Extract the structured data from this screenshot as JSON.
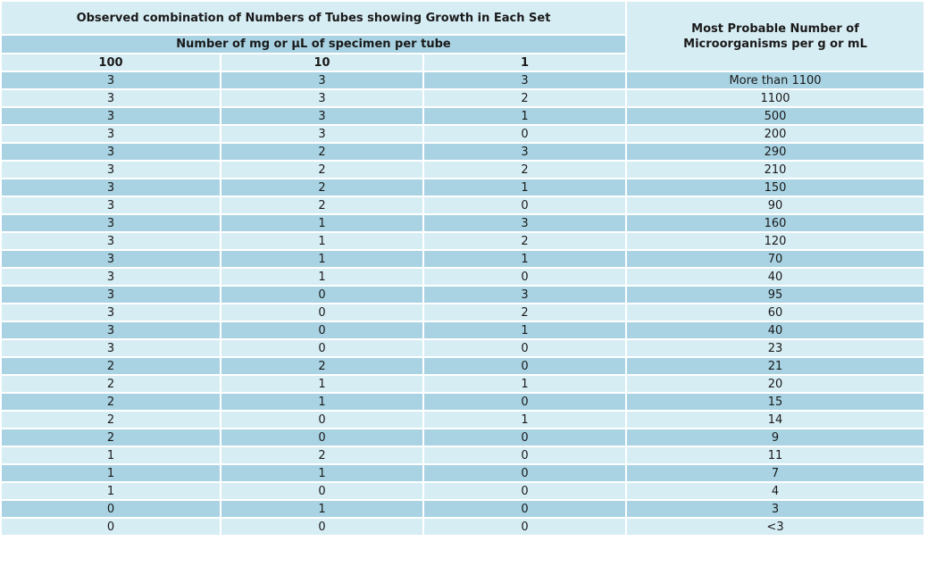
{
  "table": {
    "observed_title": "Observed combination of Numbers of Tubes showing Growth in Each Set",
    "specimen_title": "Number of mg or μL of specimen per tube",
    "mpn_title": "Most Probable Number of Microorganisms per g or mL",
    "columns": [
      "100",
      "10",
      "1"
    ],
    "rows": [
      [
        "3",
        "3",
        "3",
        "More than 1100"
      ],
      [
        "3",
        "3",
        "2",
        "1100"
      ],
      [
        "3",
        "3",
        "1",
        "500"
      ],
      [
        "3",
        "3",
        "0",
        "200"
      ],
      [
        "3",
        "2",
        "3",
        "290"
      ],
      [
        "3",
        "2",
        "2",
        "210"
      ],
      [
        "3",
        "2",
        "1",
        "150"
      ],
      [
        "3",
        "2",
        "0",
        "90"
      ],
      [
        "3",
        "1",
        "3",
        "160"
      ],
      [
        "3",
        "1",
        "2",
        "120"
      ],
      [
        "3",
        "1",
        "1",
        "70"
      ],
      [
        "3",
        "1",
        "0",
        "40"
      ],
      [
        "3",
        "0",
        "3",
        "95"
      ],
      [
        "3",
        "0",
        "2",
        "60"
      ],
      [
        "3",
        "0",
        "1",
        "40"
      ],
      [
        "3",
        "0",
        "0",
        "23"
      ],
      [
        "2",
        "2",
        "0",
        "21"
      ],
      [
        "2",
        "1",
        "1",
        "20"
      ],
      [
        "2",
        "1",
        "0",
        "15"
      ],
      [
        "2",
        "0",
        "1",
        "14"
      ],
      [
        "2",
        "0",
        "0",
        "9"
      ],
      [
        "1",
        "2",
        "0",
        "11"
      ],
      [
        "1",
        "1",
        "0",
        "7"
      ],
      [
        "1",
        "0",
        "0",
        "4"
      ],
      [
        "0",
        "1",
        "0",
        "3"
      ],
      [
        "0",
        "0",
        "0",
        "<3"
      ]
    ]
  },
  "colors": {
    "header_light": "#d7edf4",
    "row_dark": "#a9d3e3",
    "row_light": "#d7edf4"
  }
}
